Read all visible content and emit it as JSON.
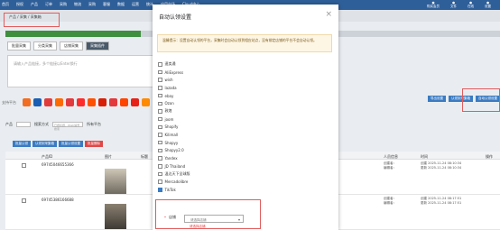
{
  "top_nav": [
    "首页",
    "授权",
    "产品",
    "订单",
    "采购",
    "物流",
    "采购",
    "客服",
    "数据",
    "运营",
    "统计",
    "应用市场",
    "Cloud中心"
  ],
  "top_right": [
    "购买会员",
    "文件",
    "在线",
    "设置"
  ],
  "breadcrumb": "产品 / 采集 / 采集箱",
  "tabs": [
    "批量采集",
    "分类采集",
    "店铺采集",
    "采集插件"
  ],
  "input_placeholder": "请输入产品链接，多个链接以Enter换行",
  "platform_label": "支持平台",
  "platform_colors": [
    "#f26d21",
    "#1a5fb4",
    "#e23b3b",
    "#ff6a00",
    "#e4393c",
    "#ff2b2b",
    "#ff5000",
    "#d81e06",
    "#e4393c",
    "#ff4400",
    "#e62117",
    "#ff8a00",
    "#e4393c",
    "#7b68ee"
  ],
  "filter": {
    "label1": "产品",
    "label2": "搜索方式",
    "placeholder": "已按标题、Wish编号搜索",
    "opt": "所有平台"
  },
  "toolbar2": [
    "批量认领",
    "认领到采集箱",
    "批量认领设置",
    "批量删除"
  ],
  "right_buttons": [
    "导出设置",
    "认领到采集箱",
    "自动认领设置"
  ],
  "table": {
    "headers": [
      "产品ID",
      "图片",
      "标题",
      "平台/店铺",
      "价格",
      "人员信息",
      "时间",
      "操作"
    ],
    "rows": [
      {
        "id": "69745046655366",
        "editor": "创建者：",
        "editor2": "编辑者：",
        "t1": "创建 2025-11-24 08:10:34",
        "t2": "更新 2025-11-24 08:10:34"
      },
      {
        "id": "69745386166688",
        "editor": "创建者：",
        "editor2": "编辑者：",
        "t1": "创建 2025-11-24 08:17:51",
        "t2": "更新 2025-11-24 08:17:51"
      }
    ]
  },
  "modal": {
    "title": "自动认领设置",
    "close": "×",
    "warn": "温馨提示：设置自动认领的平台，采集时会自动认领到相应站点，没有绑定店铺的平台不会自动认领。",
    "platforms": [
      "速卖通",
      "AliExpress",
      "wish",
      "lazada",
      "ebay",
      "Ozon",
      "敦煌",
      "joom",
      "Shopify",
      "Kilimall",
      "Shopyy",
      "Shopyy2.0",
      "Yandex",
      "JD Thailand",
      "温达天下全球版",
      "Mercadolibre",
      "TikTok"
    ],
    "checked_index": 16,
    "shop_label": "店铺",
    "shop_placeholder": "请选择店铺",
    "error": "请选择店铺"
  }
}
